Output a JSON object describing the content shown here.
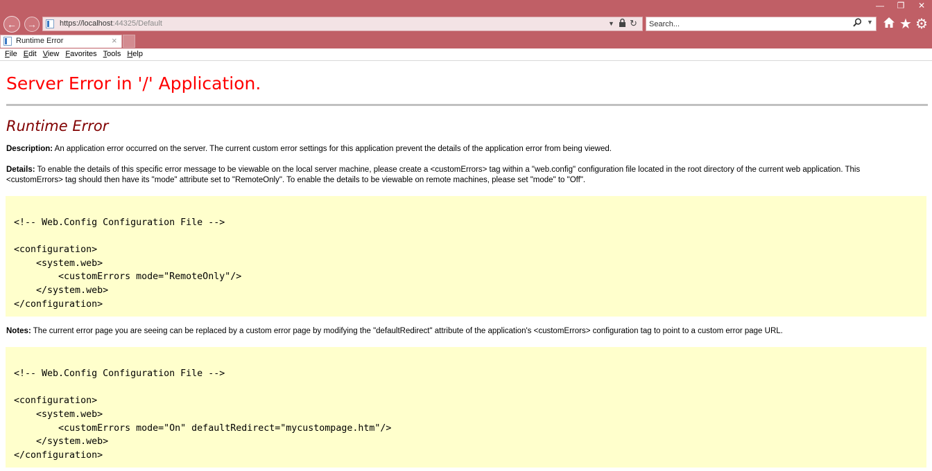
{
  "browser": {
    "url_host": "https://localhost",
    "url_rest": ":44325/Default",
    "search_placeholder": "Search...",
    "tab_title": "Runtime Error",
    "menu": [
      "File",
      "Edit",
      "View",
      "Favorites",
      "Tools",
      "Help"
    ],
    "menu_underline": [
      "F",
      "E",
      "V",
      "F",
      "T",
      "H"
    ],
    "icons": [
      "back-arrow",
      "forward-arrow",
      "lock",
      "refresh",
      "search",
      "home",
      "star",
      "gear",
      "minimize",
      "restore",
      "close"
    ],
    "accent_color": "#c05f66"
  },
  "page": {
    "title": "Server Error in '/' Application.",
    "subtitle": "Runtime Error",
    "description_label": "Description:",
    "description_text": " An application error occurred on the server. The current custom error settings for this application prevent the details of the application error from being viewed.",
    "details_label": "Details:",
    "details_text": " To enable the details of this specific error message to be viewable on the local server machine, please create a <customErrors> tag within a \"web.config\" configuration file located in the root directory of the current web application. This <customErrors> tag should then have its \"mode\" attribute set to \"RemoteOnly\". To enable the details to be viewable on remote machines, please set \"mode\" to \"Off\".",
    "code1": [
      "<!-- Web.Config Configuration File -->",
      "",
      "<configuration>",
      "    <system.web>",
      "        <customErrors mode=\"RemoteOnly\"/>",
      "    </system.web>",
      "</configuration>"
    ],
    "notes_label": "Notes:",
    "notes_text": " The current error page you are seeing can be replaced by a custom error page by modifying the \"defaultRedirect\" attribute of the application's <customErrors> configuration tag to point to a custom error page URL.",
    "code2": [
      "<!-- Web.Config Configuration File -->",
      "",
      "<configuration>",
      "    <system.web>",
      "        <customErrors mode=\"On\" defaultRedirect=\"mycustompage.htm\"/>",
      "    </system.web>",
      "</configuration>"
    ],
    "colors": {
      "title": "#ff0000",
      "subtitle": "#800000",
      "code_background": "#ffffcc",
      "rule": "#c0c0c0"
    }
  }
}
